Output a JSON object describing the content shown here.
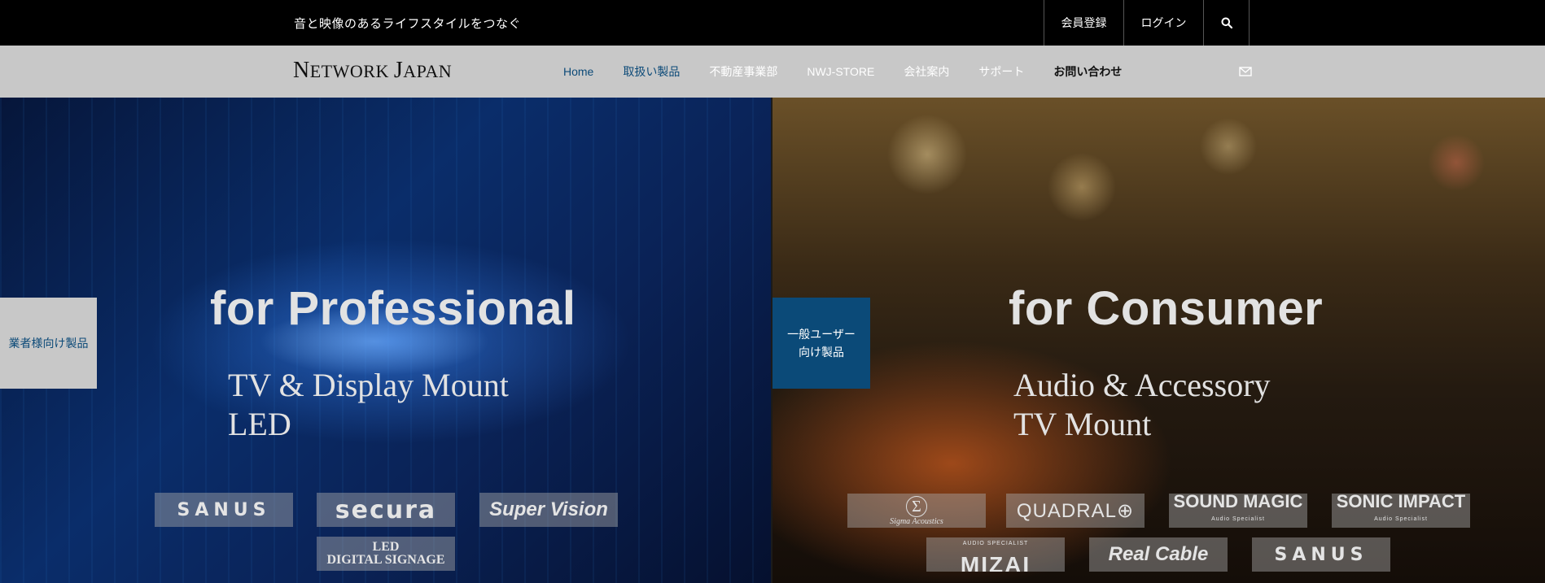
{
  "topbar": {
    "tagline": "音と映像のあるライフスタイルをつなぐ",
    "register_label": "会員登録",
    "login_label": "ログイン"
  },
  "navbar": {
    "logo_first": "N",
    "logo_rest1": "ETWORK ",
    "logo_second": "J",
    "logo_rest2": "APAN",
    "items": [
      {
        "label": "Home"
      },
      {
        "label": "取扱い製品"
      },
      {
        "label": "不動産事業部"
      },
      {
        "label": "NWJ-STORE"
      },
      {
        "label": "会社案内"
      },
      {
        "label": "サポート"
      },
      {
        "label": "お問い合わせ"
      }
    ]
  },
  "hero_pro": {
    "tab_label": "業者様向け製品",
    "title": "for Professional",
    "sub_line1": "TV & Display Mount",
    "sub_line2": "LED",
    "brands": {
      "sanus": "SANUS",
      "secura": "secura",
      "supervision": "Super Vision",
      "led_line1": "LED",
      "led_line2": "DIGITAL SIGNAGE"
    }
  },
  "hero_con": {
    "tab_line1": "一般ユーザー",
    "tab_line2": "向け製品",
    "title": "for Consumer",
    "sub_line1": "Audio & Accessory",
    "sub_line2": "TV Mount",
    "brands": {
      "sigma_symbol": "Σ",
      "sigma_name": "Sigma Acoustics",
      "quadral": "QUADRAL⊕",
      "soundmagic": "SOUND MAGIC",
      "soundmagic_sub": "Audio Specialist",
      "sonicimpact": "SONIC IMPACT",
      "sonicimpact_sub": "Audio Specialist",
      "mizai_sub": "AUDIO SPECIALIST",
      "mizai": "MIZAI",
      "realcable": "Real Cable",
      "sanus": "SANUS"
    }
  },
  "icons": {
    "search": "search-icon",
    "mail": "mail-icon"
  },
  "colors": {
    "accent_blue": "#0b4a78",
    "nav_bg": "#c8c8c8",
    "topbar_bg": "#000000"
  }
}
